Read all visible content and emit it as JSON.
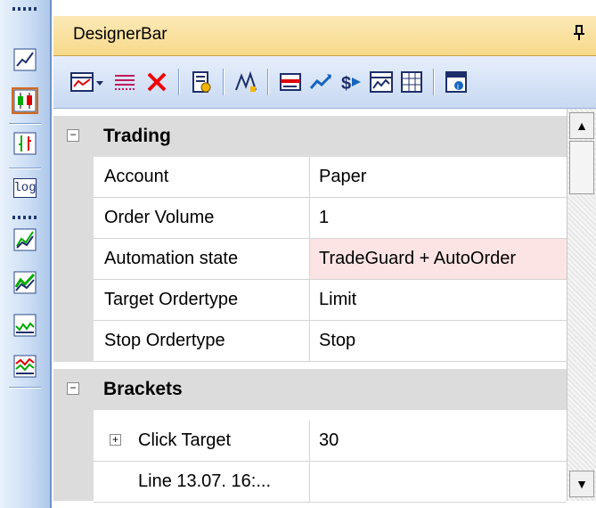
{
  "panel": {
    "title": "DesignerBar",
    "pin_glyph": "q"
  },
  "colors": {
    "title_bg": "#f8d98a",
    "active_button": "#f7c386",
    "highlight_value_bg": "#fde4e4",
    "category_bg": "#dcdcdc"
  },
  "left_toolbar": {
    "items": [
      {
        "icon": "line-chart-icon"
      },
      {
        "icon": "candlestick-chart-icon",
        "active": true
      },
      {
        "icon": "bar-chart-icon"
      },
      {
        "icon": "log-scale-icon",
        "label": "log"
      },
      {
        "icon": "indicator-1-icon"
      },
      {
        "icon": "indicator-2-icon"
      },
      {
        "icon": "indicator-3-icon"
      },
      {
        "icon": "indicator-4-icon"
      }
    ]
  },
  "toolbar": {
    "items": [
      "chart-template-icon",
      "dropdown-arrow-icon",
      "list-icon",
      "delete-icon",
      "properties-icon",
      "drawing-tool-icon",
      "order-icon",
      "trend-icon",
      "currency-icon",
      "chart-window-icon",
      "grid-icon",
      "info-icon"
    ]
  },
  "grid": {
    "categories": [
      {
        "label": "Trading",
        "expander": "−",
        "rows": [
          {
            "name": "Account",
            "value": "Paper"
          },
          {
            "name": "Order Volume",
            "value": "1"
          },
          {
            "name": "Automation state",
            "value": "TradeGuard + AutoOrder",
            "highlight": true
          },
          {
            "name": "Target Ordertype",
            "value": "Limit"
          },
          {
            "name": "Stop Ordertype",
            "value": "Stop"
          }
        ]
      },
      {
        "label": "Brackets",
        "expander": "−",
        "rows": [
          {
            "name": "Click Target",
            "value": "30",
            "expander": "+"
          },
          {
            "name": "Line 13.07. 16:...",
            "value": ""
          }
        ]
      }
    ]
  },
  "scrollbar": {
    "up_glyph": "▲",
    "down_glyph": "▼"
  }
}
